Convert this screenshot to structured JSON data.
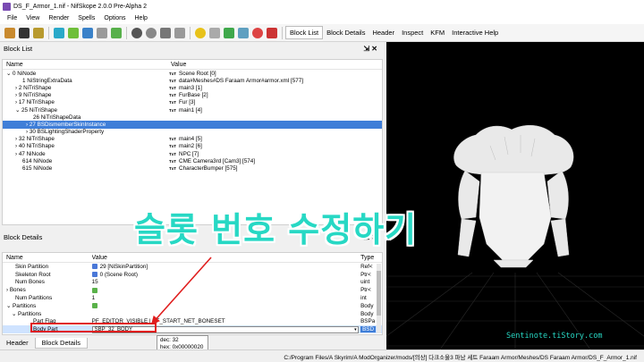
{
  "window": {
    "title": "DS_F_Armor_1.nif - NifSkope 2.0.0 Pre-Alpha 2"
  },
  "menu": [
    "File",
    "View",
    "Render",
    "Spells",
    "Options",
    "Help"
  ],
  "toolbar_tabs": [
    "Block List",
    "Block Details",
    "Header",
    "Inspect",
    "KFM",
    "Interactive Help"
  ],
  "block_list": {
    "title": "Block List",
    "columns": [
      "Name",
      "Value"
    ],
    "rows": [
      {
        "name": "0 NiNode",
        "value": "Scene Root [0]"
      },
      {
        "name": "1 NiStringExtraData",
        "value": "data#Meshes#DS Faraam Armor#armor.xml [577]"
      },
      {
        "name": "2 NiTriShape",
        "value": "main3 [1]"
      },
      {
        "name": "9 NiTriShape",
        "value": "FurBase [2]"
      },
      {
        "name": "17 NiTriShape",
        "value": "Fur [3]"
      },
      {
        "name": "25 NiTriShape",
        "value": "main1 [4]"
      },
      {
        "name": "26 NiTriShapeData",
        "value": ""
      },
      {
        "name": "27 BSDismemberSkinInstance",
        "value": ""
      },
      {
        "name": "30 BSLightingShaderProperty",
        "value": ""
      },
      {
        "name": "32 NiTriShape",
        "value": "main4 [5]"
      },
      {
        "name": "40 NiTriShape",
        "value": "main2 [6]"
      },
      {
        "name": "47 NiNode",
        "value": "NPC [7]"
      },
      {
        "name": "614 NiNode",
        "value": "CME Camera3rd [Cam3] [574]"
      },
      {
        "name": "615 NiNode",
        "value": "CharacterBumper [575]"
      }
    ]
  },
  "block_details": {
    "title": "Block Details",
    "columns": [
      "Name",
      "Value",
      "Type"
    ],
    "rows": [
      {
        "name": "Skin Partition",
        "value": "29 [NiSkinPartition]",
        "type": "Ref<"
      },
      {
        "name": "Skeleton Root",
        "value": "0 (Scene Root)",
        "type": "Ptr<"
      },
      {
        "name": "Num Bones",
        "value": "15",
        "type": "uint"
      },
      {
        "name": "Bones",
        "value": "",
        "type": "Ptr<"
      },
      {
        "name": "Num Partitions",
        "value": "1",
        "type": "int"
      },
      {
        "name": "Partitions",
        "value": "",
        "type": "Body"
      },
      {
        "name": "Partitions",
        "value": "",
        "type": "Body"
      },
      {
        "name": "Part Flag",
        "value": "PF_EDITOR_VISIBLE | PF_START_NET_BONESET",
        "type": "BSPa"
      },
      {
        "name": "Body Part",
        "value": "SBP_32_BODY",
        "type": "BSD"
      }
    ]
  },
  "bottom_tabs": [
    "Header",
    "Block Details"
  ],
  "tooltip": {
    "dec": "dec: 32",
    "hex": "hex: 0x00000020"
  },
  "status_path": "C:/Program Files/A Skyrim/A ModOrganizer/mods/[의상] 다크소울3 파남 세트 Faraam Armor/Meshes/DS Faraam Armor/DS_F_Armor_1.nif",
  "caption": "슬롯 번호 수정하기",
  "watermark": "Sentinote.tiStory.com",
  "labels": {
    "txt": "TxT",
    "pin": "⇲ ✕"
  },
  "colors": {
    "caption": "#27d8c4",
    "selection": "#3f7ed8",
    "highlight_box": "#e01e1e"
  }
}
